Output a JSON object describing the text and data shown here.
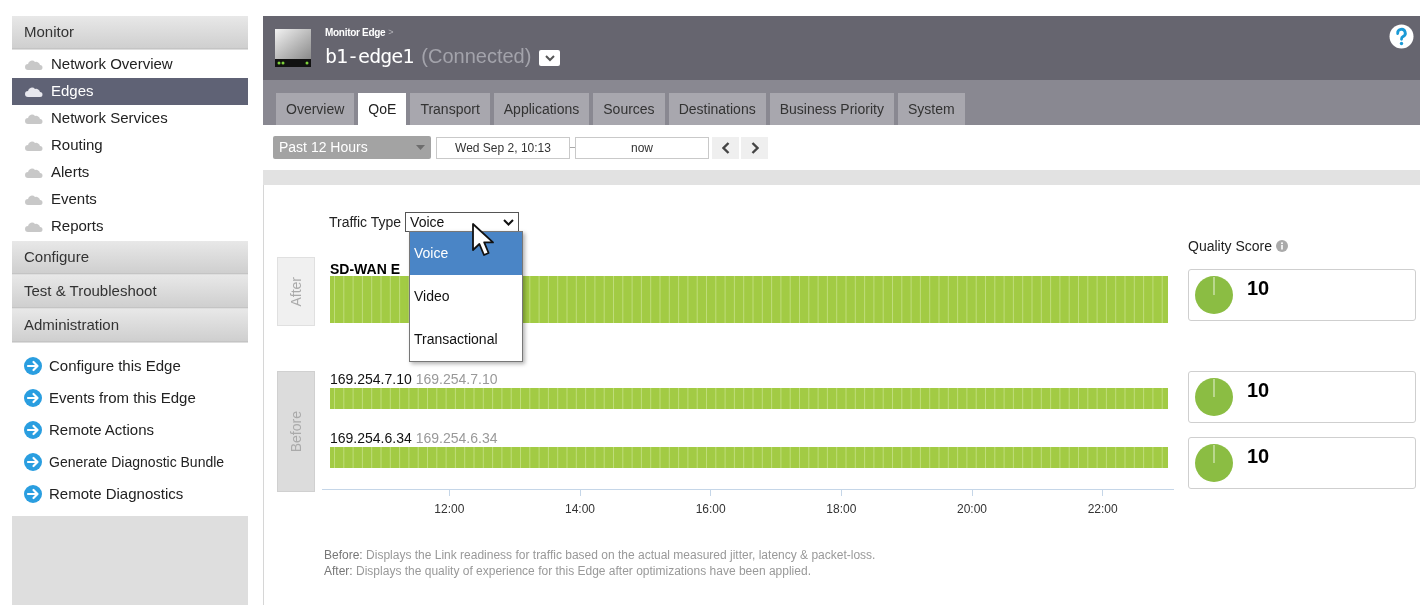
{
  "sidebar": {
    "sections": [
      {
        "title": "Monitor",
        "items": [
          {
            "label": "Network Overview",
            "selected": false
          },
          {
            "label": "Edges",
            "selected": true
          },
          {
            "label": "Network Services",
            "selected": false
          },
          {
            "label": "Routing",
            "selected": false
          },
          {
            "label": "Alerts",
            "selected": false
          },
          {
            "label": "Events",
            "selected": false
          },
          {
            "label": "Reports",
            "selected": false
          }
        ]
      },
      {
        "title": "Configure"
      },
      {
        "title": "Test & Troubleshoot"
      },
      {
        "title": "Administration",
        "links": [
          "Configure this Edge",
          "Events from this Edge",
          "Remote Actions",
          "Generate Diagnostic Bundle",
          "Remote Diagnostics"
        ]
      }
    ]
  },
  "header": {
    "breadcrumb": "Monitor Edge",
    "breadcrumb_separator": ">",
    "edge_name": "b1-edge1",
    "status": "(Connected)"
  },
  "tabs": [
    {
      "label": "Overview",
      "selected": false
    },
    {
      "label": "QoE",
      "selected": true
    },
    {
      "label": "Transport",
      "selected": false
    },
    {
      "label": "Applications",
      "selected": false
    },
    {
      "label": "Sources",
      "selected": false
    },
    {
      "label": "Destinations",
      "selected": false
    },
    {
      "label": "Business Priority",
      "selected": false
    },
    {
      "label": "System",
      "selected": false
    }
  ],
  "toolbar": {
    "range": "Past 12 Hours",
    "start": "Wed Sep 2, 10:13",
    "end": "now"
  },
  "qoe": {
    "traffic_type_label": "Traffic Type",
    "traffic_type_value": "Voice",
    "traffic_options": [
      {
        "label": "Voice",
        "selected": true
      },
      {
        "label": "Video",
        "selected": false
      },
      {
        "label": "Transactional",
        "selected": false
      }
    ],
    "after_label": "After",
    "before_label": "Before",
    "after_link": {
      "name": "SD-WAN E",
      "score": "10"
    },
    "before_links": [
      {
        "name": "169.254.7.10",
        "address": "169.254.7.10",
        "score": "10"
      },
      {
        "name": "169.254.6.34",
        "address": "169.254.6.34",
        "score": "10"
      }
    ],
    "axis_ticks": [
      "12:00",
      "14:00",
      "16:00",
      "18:00",
      "20:00",
      "22:00"
    ],
    "quality_label": "Quality Score",
    "notes": [
      {
        "term": "Before:",
        "text": "Displays the Link readiness for traffic based on the actual measured jitter, latency & packet-loss."
      },
      {
        "term": "After:",
        "text": "Displays the quality of experience for this Edge after optimizations have been applied."
      }
    ]
  }
}
